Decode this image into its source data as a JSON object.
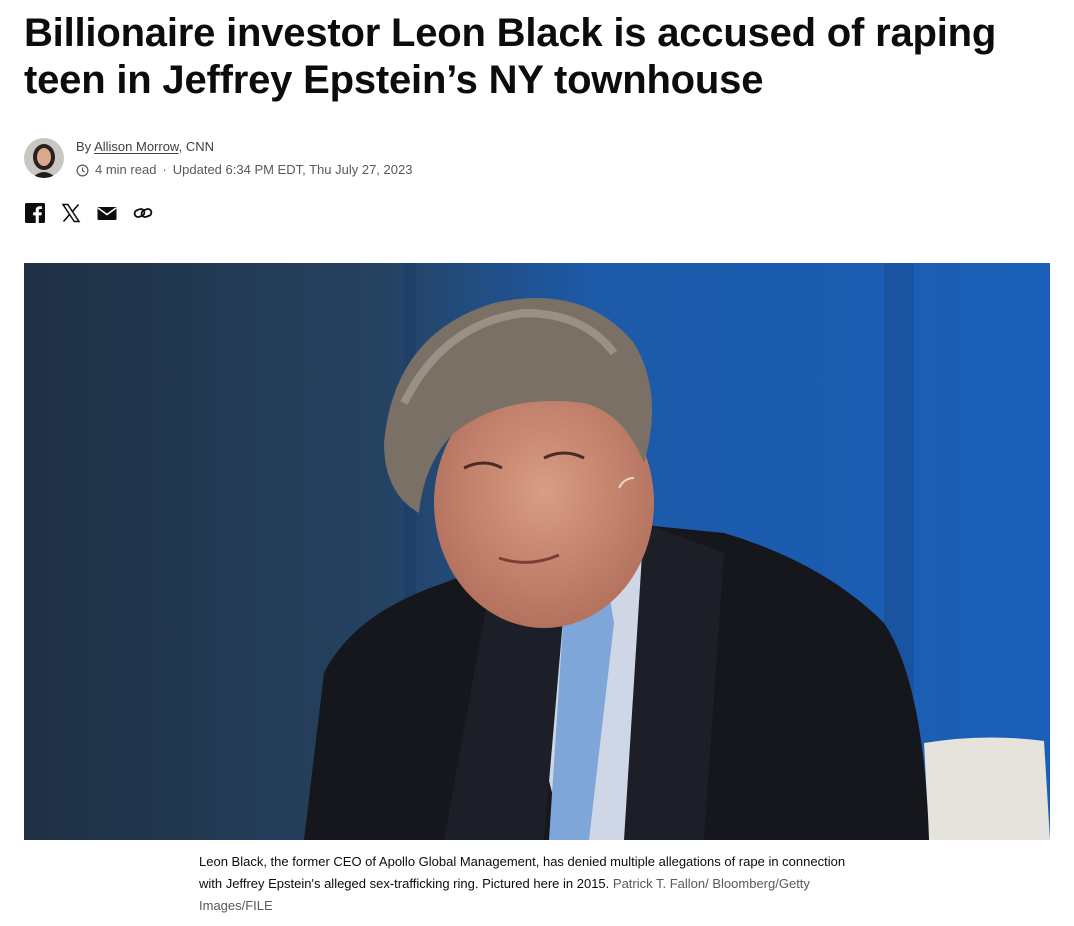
{
  "article": {
    "headline": "Billionaire investor Leon Black is accused of raping teen in Jeffrey Epstein’s NY townhouse",
    "byline_prefix": "By ",
    "author": "Allison Morrow",
    "outlet": ", CNN",
    "read_time": "4 min read",
    "separator": "·",
    "updated": "Updated 6:34 PM EDT, Thu July 27, 2023"
  },
  "share": {
    "icons": [
      "facebook-icon",
      "x-icon",
      "email-icon",
      "link-icon"
    ]
  },
  "image": {
    "caption": "Leon Black, the former CEO of Apollo Global Management, has denied multiple allegations of rape in connection with Jeffrey Epstein's alleged sex-trafficking ring. Pictured here in 2015.",
    "credit": "Patrick T. Fallon/ Bloomberg/Getty Images/FILE"
  },
  "colors": {
    "text": "#0c0c0c",
    "meta": "#595959",
    "hero_bg": "#1f5aa8"
  }
}
